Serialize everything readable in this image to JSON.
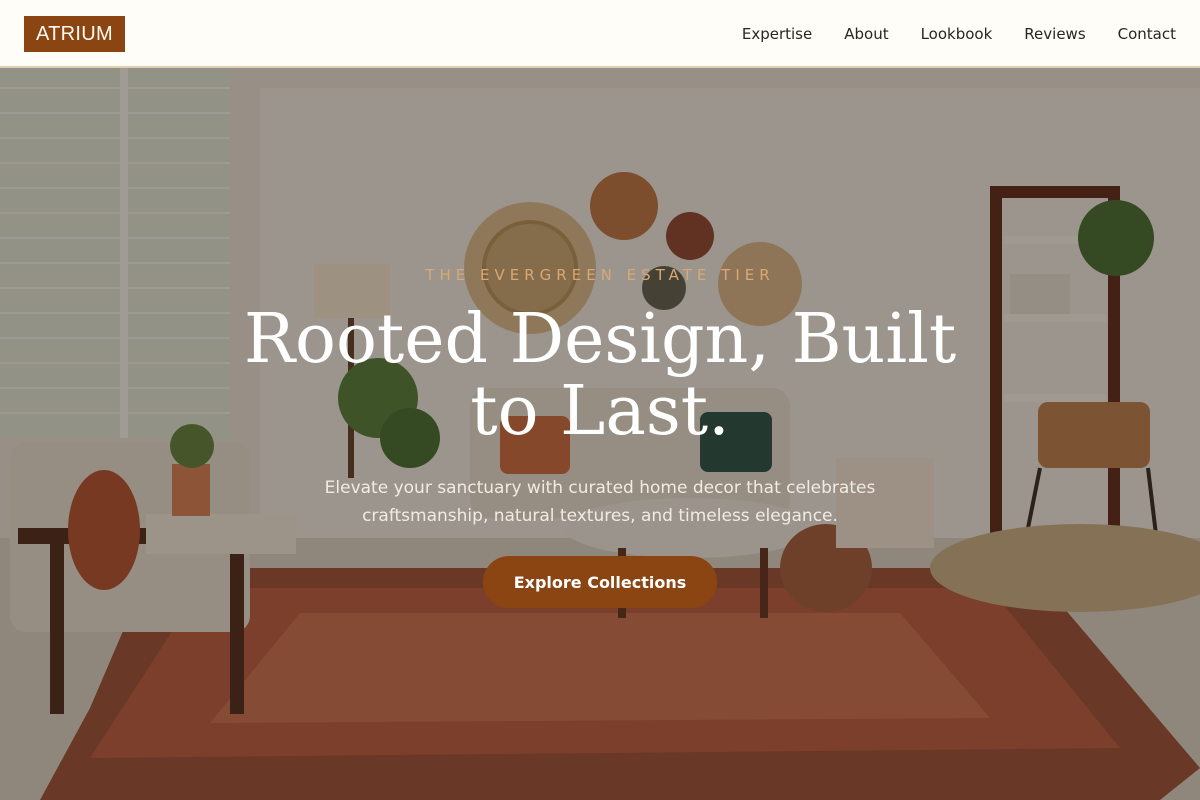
{
  "brand": {
    "name": "ATRIUM"
  },
  "nav": {
    "items": [
      {
        "label": "Expertise"
      },
      {
        "label": "About"
      },
      {
        "label": "Lookbook"
      },
      {
        "label": "Reviews"
      },
      {
        "label": "Contact"
      }
    ]
  },
  "hero": {
    "eyebrow": "THE EVERGREEN ESTATE TIER",
    "title": "Rooted Design, Built to Last.",
    "subtitle": "Elevate your sanctuary with curated home decor that celebrates craftsmanship, natural textures, and timeless elegance.",
    "cta_label": "Explore Collections"
  },
  "colors": {
    "accent": "#8b4513",
    "eyebrow": "#d9a873",
    "header_bg": "#fffdf8",
    "header_border": "#e2cfae"
  }
}
